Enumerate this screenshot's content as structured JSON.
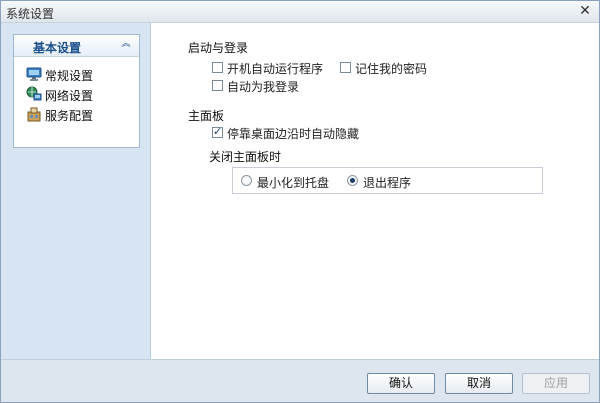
{
  "window": {
    "title": "系统设置"
  },
  "sidebar": {
    "panel_title": "基本设置",
    "items": [
      {
        "label": "常规设置",
        "icon": "monitor-icon"
      },
      {
        "label": "网络设置",
        "icon": "network-icon"
      },
      {
        "label": "服务配置",
        "icon": "service-icon"
      }
    ]
  },
  "startup": {
    "title": "启动与登录",
    "auto_run": {
      "label": "开机自动运行程序",
      "checked": false
    },
    "remember_password": {
      "label": "记住我的密码",
      "checked": false
    },
    "auto_login": {
      "label": "自动为我登录",
      "checked": false
    }
  },
  "main_panel": {
    "title": "主面板",
    "auto_hide": {
      "label": "停靠桌面边沿时自动隐藏",
      "checked": true
    },
    "close_title": "关闭主面板时",
    "minimize_option": {
      "label": "最小化到托盘",
      "selected": false
    },
    "exit_option": {
      "label": "退出程序",
      "selected": true
    }
  },
  "buttons": {
    "ok": "确认",
    "cancel": "取消",
    "apply": "应用"
  },
  "colors": {
    "sidebar_bg": "#d7e5f3",
    "accent": "#1a4f8a",
    "footer_bg": "#dde6ef"
  }
}
